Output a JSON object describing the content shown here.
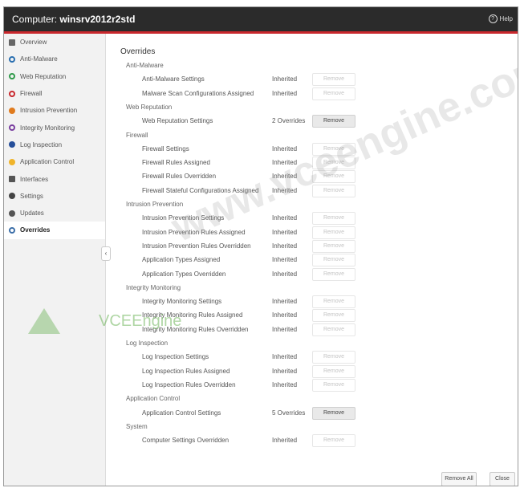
{
  "header": {
    "title_prefix": "Computer: ",
    "title_host": "winsrv2012r2std",
    "help": "Help"
  },
  "sidebar": {
    "items": [
      {
        "label": "Overview",
        "color": "#666666",
        "shape": "sq",
        "active": false
      },
      {
        "label": "Anti-Malware",
        "color": "#2a6fb0",
        "shape": "ring",
        "active": false
      },
      {
        "label": "Web Reputation",
        "color": "#2f9a4a",
        "shape": "ring",
        "active": false
      },
      {
        "label": "Firewall",
        "color": "#c9282d",
        "shape": "ring",
        "active": false
      },
      {
        "label": "Intrusion Prevention",
        "color": "#e07b1e",
        "shape": "dot",
        "active": false
      },
      {
        "label": "Integrity Monitoring",
        "color": "#7a3fa0",
        "shape": "ring",
        "active": false
      },
      {
        "label": "Log Inspection",
        "color": "#264f9a",
        "shape": "dot",
        "active": false
      },
      {
        "label": "Application Control",
        "color": "#f0b42a",
        "shape": "dot",
        "active": false
      },
      {
        "label": "Interfaces",
        "color": "#555555",
        "shape": "sq",
        "active": false
      },
      {
        "label": "Settings",
        "color": "#444444",
        "shape": "dot",
        "active": false
      },
      {
        "label": "Updates",
        "color": "#555555",
        "shape": "dot",
        "active": false
      },
      {
        "label": "Overrides",
        "color": "#3b6ea8",
        "shape": "ring",
        "active": true
      }
    ]
  },
  "main": {
    "heading": "Overrides",
    "remove_label": "Remove",
    "rows": [
      {
        "type": "section",
        "name": "Anti-Malware"
      },
      {
        "type": "setting",
        "name": "Anti-Malware Settings",
        "status": "Inherited",
        "enabled": false
      },
      {
        "type": "setting",
        "name": "Malware Scan Configurations Assigned",
        "status": "Inherited",
        "enabled": false
      },
      {
        "type": "section",
        "name": "Web Reputation"
      },
      {
        "type": "setting",
        "name": "Web Reputation Settings",
        "status": "2 Overrides",
        "enabled": true
      },
      {
        "type": "section",
        "name": "Firewall"
      },
      {
        "type": "setting",
        "name": "Firewall Settings",
        "status": "Inherited",
        "enabled": false
      },
      {
        "type": "setting",
        "name": "Firewall Rules Assigned",
        "status": "Inherited",
        "enabled": false
      },
      {
        "type": "setting",
        "name": "Firewall Rules Overridden",
        "status": "Inherited",
        "enabled": false
      },
      {
        "type": "setting",
        "name": "Firewall Stateful Configurations Assigned",
        "status": "Inherited",
        "enabled": false
      },
      {
        "type": "section",
        "name": "Intrusion Prevention"
      },
      {
        "type": "setting",
        "name": "Intrusion Prevention Settings",
        "status": "Inherited",
        "enabled": false
      },
      {
        "type": "setting",
        "name": "Intrusion Prevention Rules Assigned",
        "status": "Inherited",
        "enabled": false
      },
      {
        "type": "setting",
        "name": "Intrusion Prevention Rules Overridden",
        "status": "Inherited",
        "enabled": false
      },
      {
        "type": "setting",
        "name": "Application Types Assigned",
        "status": "Inherited",
        "enabled": false
      },
      {
        "type": "setting",
        "name": "Application Types Overridden",
        "status": "Inherited",
        "enabled": false
      },
      {
        "type": "section",
        "name": "Integrity Monitoring"
      },
      {
        "type": "setting",
        "name": "Integrity Monitoring Settings",
        "status": "Inherited",
        "enabled": false
      },
      {
        "type": "setting",
        "name": "Integrity Monitoring Rules Assigned",
        "status": "Inherited",
        "enabled": false
      },
      {
        "type": "setting",
        "name": "Integrity Monitoring Rules Overridden",
        "status": "Inherited",
        "enabled": false
      },
      {
        "type": "section",
        "name": "Log Inspection"
      },
      {
        "type": "setting",
        "name": "Log Inspection Settings",
        "status": "Inherited",
        "enabled": false
      },
      {
        "type": "setting",
        "name": "Log Inspection Rules Assigned",
        "status": "Inherited",
        "enabled": false
      },
      {
        "type": "setting",
        "name": "Log Inspection Rules Overridden",
        "status": "Inherited",
        "enabled": false
      },
      {
        "type": "section",
        "name": "Application Control"
      },
      {
        "type": "setting",
        "name": "Application Control Settings",
        "status": "5 Overrides",
        "enabled": true
      },
      {
        "type": "section",
        "name": "System"
      },
      {
        "type": "setting",
        "name": "Computer Settings Overridden",
        "status": "Inherited",
        "enabled": false
      }
    ]
  },
  "footer": {
    "remove_all": "Remove All",
    "close": "Close"
  },
  "watermark": {
    "text": "www.vceengine.com",
    "logo_text": "VCEEngine"
  }
}
